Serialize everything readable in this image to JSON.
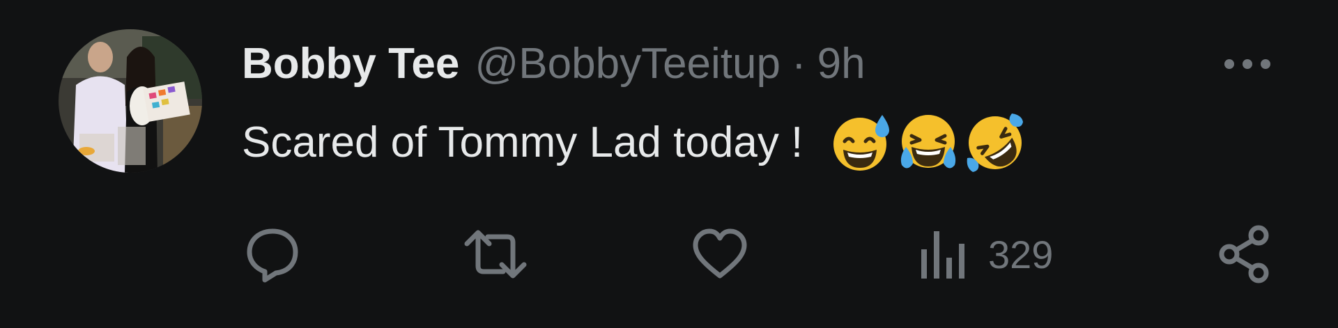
{
  "tweet": {
    "author": {
      "display_name": "Bobby Tee",
      "handle": "@BobbyTeeitup"
    },
    "separator": "·",
    "timestamp": "9h",
    "text": "Scared of Tommy Lad today !",
    "emojis": [
      "grinning-sweat-emoji",
      "tears-of-joy-emoji",
      "rolling-on-floor-laughing-emoji"
    ],
    "actions": {
      "reply_icon": "speech-bubble-icon",
      "retweet_icon": "retweet-arrows-icon",
      "like_icon": "heart-icon",
      "views_icon": "bar-chart-icon",
      "views_count": "329",
      "share_icon": "share-icon",
      "more_icon": "ellipsis-icon"
    }
  },
  "colors": {
    "background": "#111213",
    "primary_text": "#e7e9ea",
    "secondary_text": "#71767b",
    "emoji_yellow": "#f5c02c",
    "emoji_tear": "#4aa8e8"
  }
}
